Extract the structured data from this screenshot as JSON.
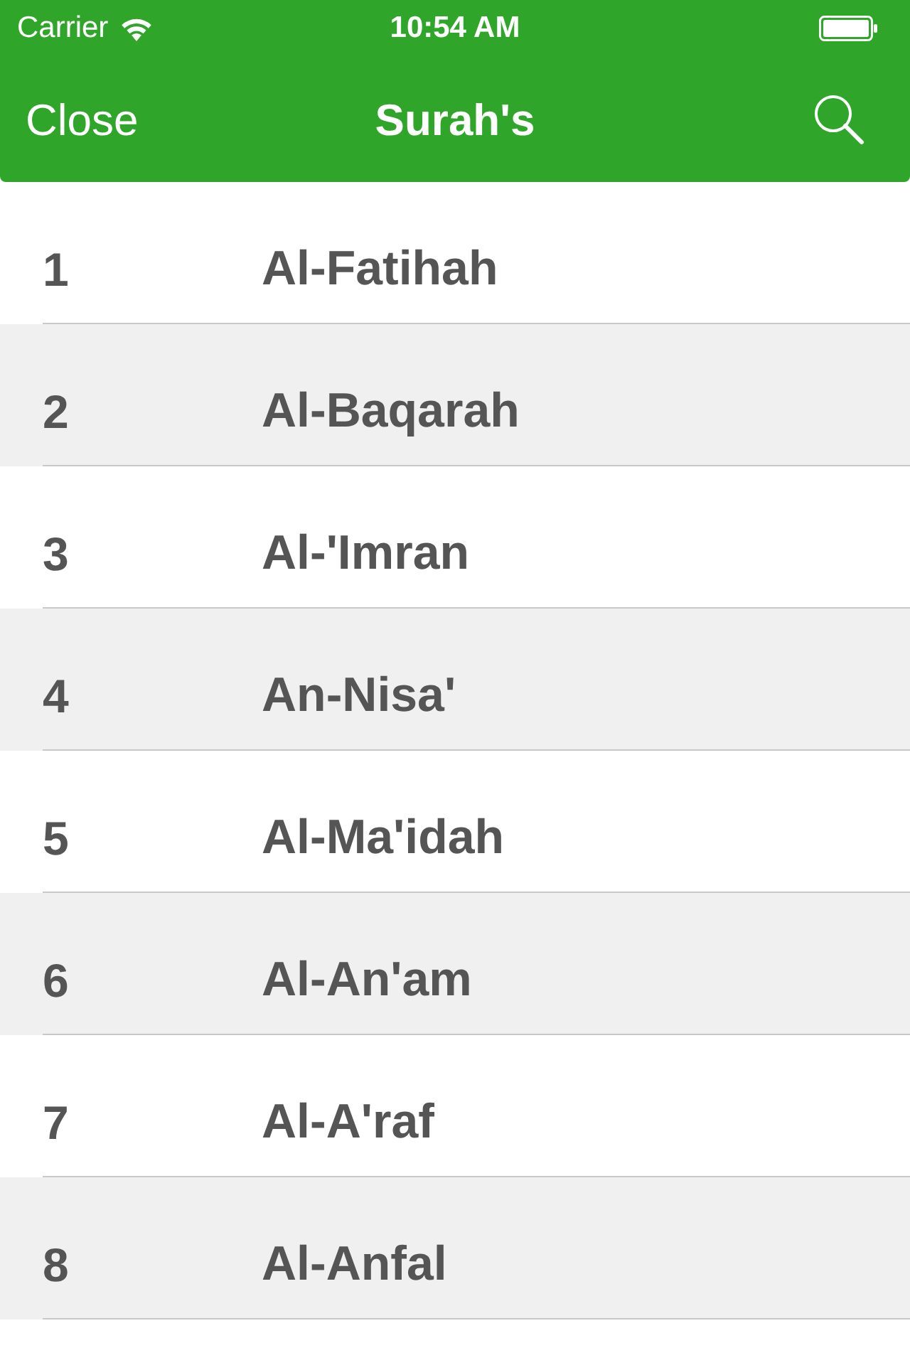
{
  "status_bar": {
    "carrier": "Carrier",
    "time": "10:54 AM"
  },
  "nav_bar": {
    "left_button": "Close",
    "title": "Surah's"
  },
  "surahs": [
    {
      "number": "1",
      "name": "Al-Fatihah"
    },
    {
      "number": "2",
      "name": "Al-Baqarah"
    },
    {
      "number": "3",
      "name": "Al-'Imran"
    },
    {
      "number": "4",
      "name": "An-Nisa'"
    },
    {
      "number": "5",
      "name": "Al-Ma'idah"
    },
    {
      "number": "6",
      "name": "Al-An'am"
    },
    {
      "number": "7",
      "name": "Al-A'raf"
    },
    {
      "number": "8",
      "name": "Al-Anfal"
    }
  ]
}
